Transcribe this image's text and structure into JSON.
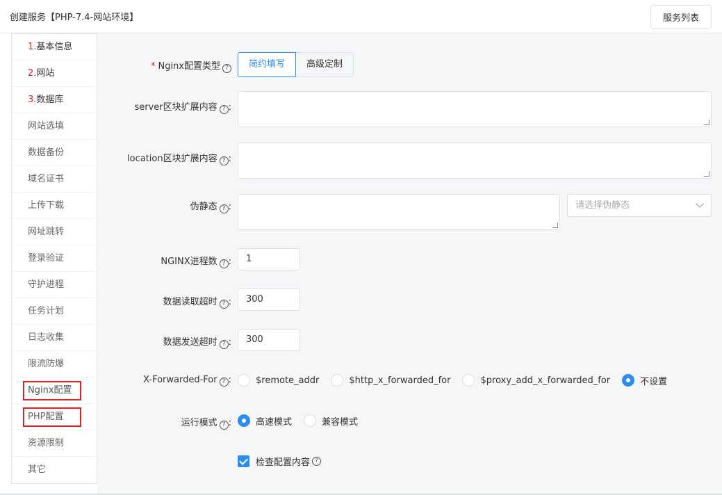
{
  "header": {
    "title": "创建服务【PHP-7.4-网站环境】",
    "list_button": "服务列表"
  },
  "sidebar": {
    "items": [
      {
        "num": "1.",
        "label": "基本信息"
      },
      {
        "num": "2.",
        "label": "网站"
      },
      {
        "num": "3.",
        "label": "数据库"
      },
      {
        "label": "网站选填"
      },
      {
        "label": "数据备份"
      },
      {
        "label": "域名证书"
      },
      {
        "label": "上传下载"
      },
      {
        "label": "网址跳转"
      },
      {
        "label": "登录验证"
      },
      {
        "label": "守护进程"
      },
      {
        "label": "任务计划"
      },
      {
        "label": "日志收集"
      },
      {
        "label": "限流防爆"
      },
      {
        "label": "Nginx配置"
      },
      {
        "label": "PHP配置"
      },
      {
        "label": "资源限制"
      },
      {
        "label": "其它"
      }
    ]
  },
  "form": {
    "nginx_type": {
      "label": "Nginx配置类型",
      "required": "*",
      "simple": "简约填写",
      "advanced": "高级定制"
    },
    "server_ext": {
      "label": "server区块扩展内容",
      "value": ""
    },
    "location_ext": {
      "label": "location区块扩展内容",
      "value": ""
    },
    "rewrite": {
      "label": "伪静态",
      "value": "",
      "select_placeholder": "请选择伪静态"
    },
    "nginx_workers": {
      "label": "NGINX进程数",
      "value": "1"
    },
    "read_timeout": {
      "label": "数据读取超时",
      "value": "300"
    },
    "send_timeout": {
      "label": "数据发送超时",
      "value": "300"
    },
    "xff": {
      "label": "X-Forwarded-For",
      "options": [
        "$remote_addr",
        "$http_x_forwarded_for",
        "$proxy_add_x_forwarded_for",
        "不设置"
      ],
      "selected": "不设置"
    },
    "run_mode": {
      "label": "运行模式",
      "options": [
        "高速模式",
        "兼容模式"
      ],
      "selected": "高速模式"
    },
    "check_config": {
      "label": "检查配置内容",
      "checked": true
    }
  },
  "colors": {
    "accent": "#2d8cf0",
    "highlight_box": "#e02020"
  }
}
